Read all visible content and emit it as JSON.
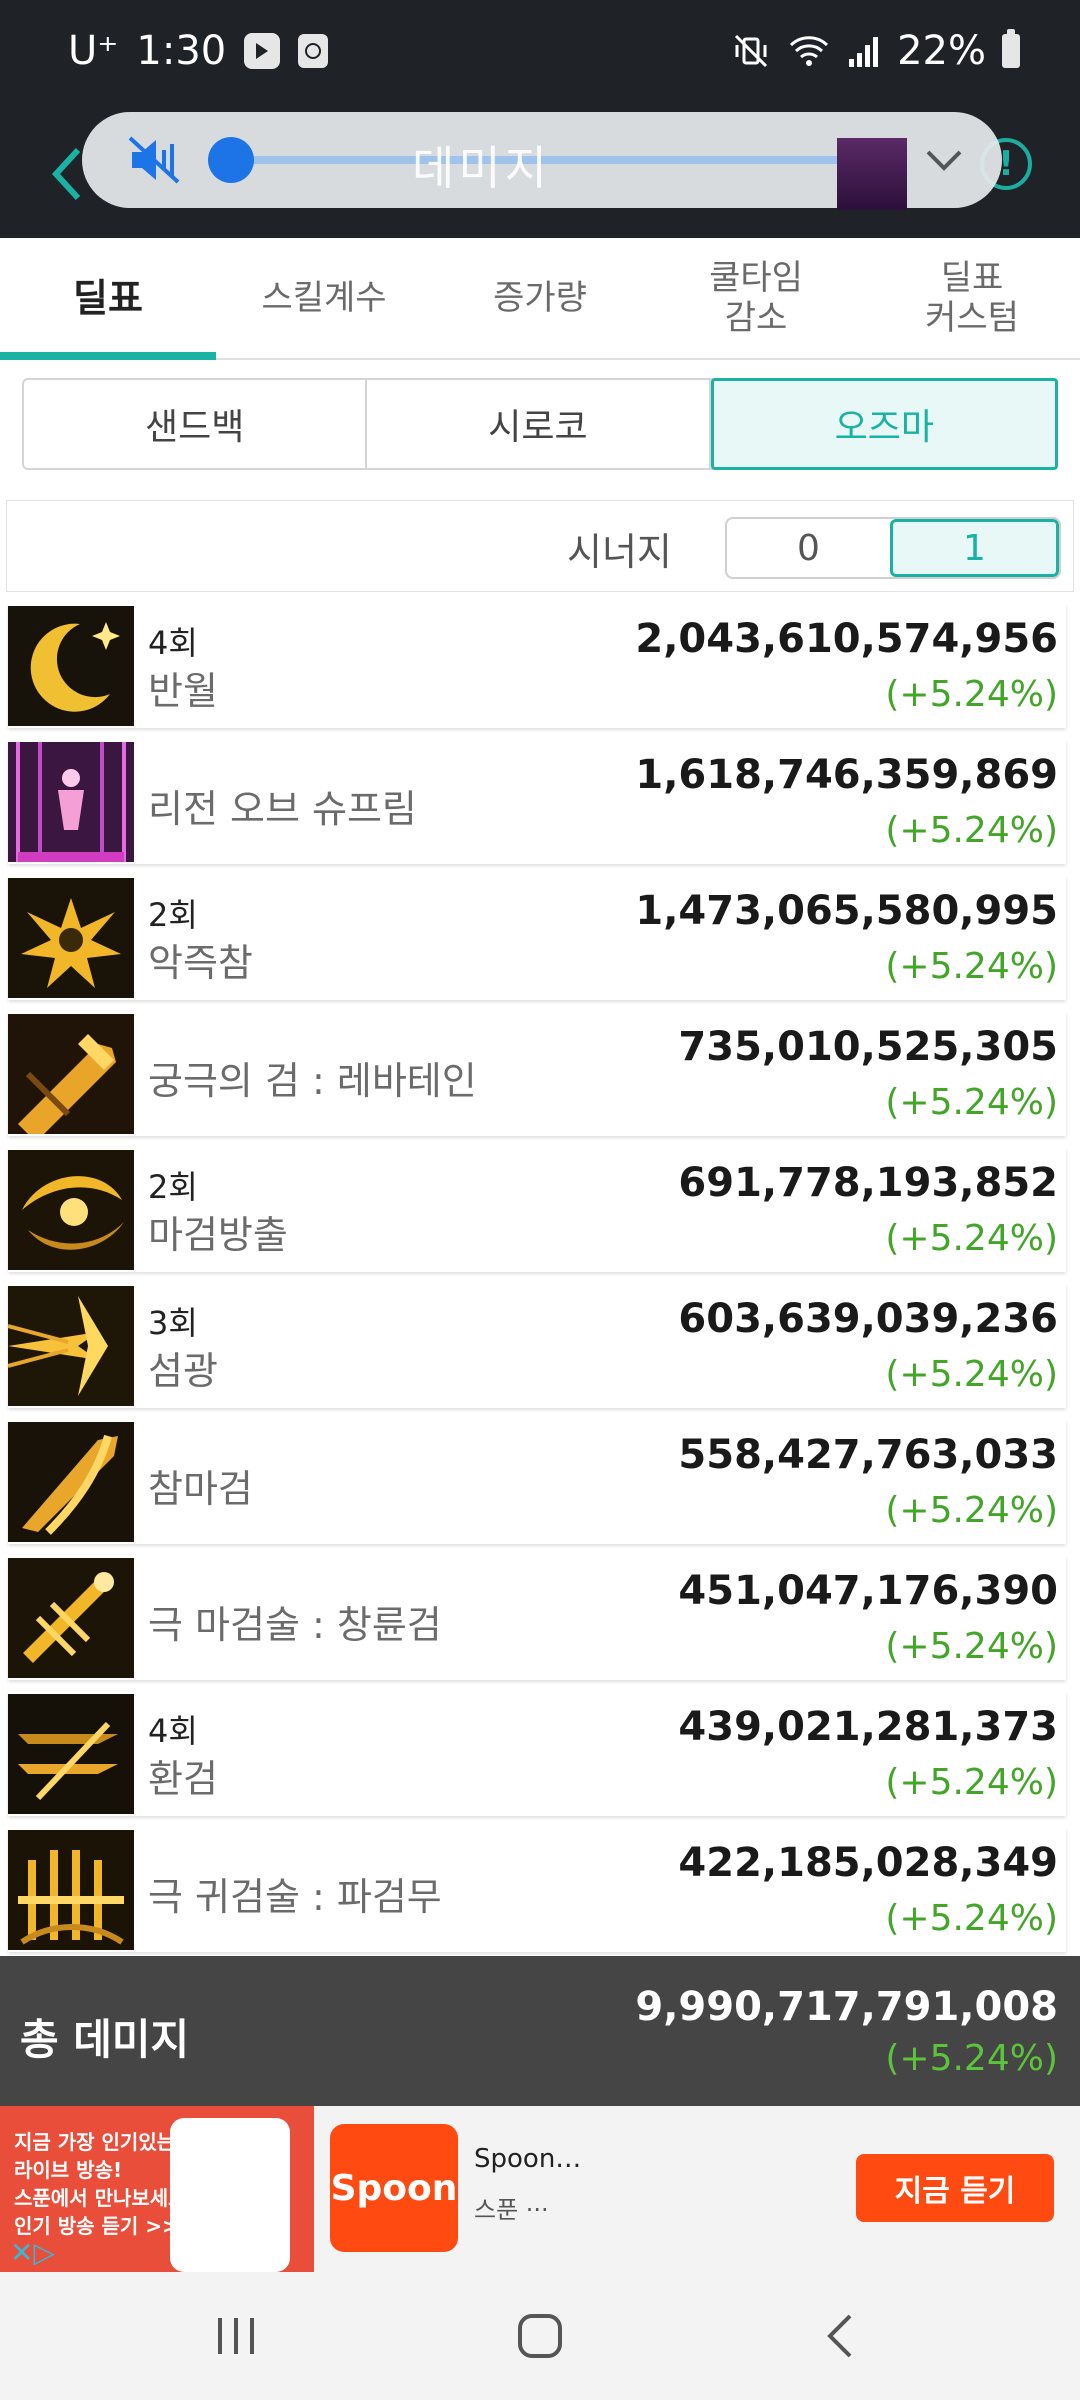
{
  "status_bar": {
    "carrier": "U⁺",
    "time": "1:30",
    "battery": "22%"
  },
  "volume_overlay": {
    "title": "데미지",
    "level": 0
  },
  "tabs": [
    {
      "label": "딜표",
      "active": true
    },
    {
      "label": "스킬계수",
      "active": false
    },
    {
      "label": "증가량",
      "active": false
    },
    {
      "label": "쿨타임\n감소",
      "active": false
    },
    {
      "label": "딜표\n커스텀",
      "active": false
    }
  ],
  "segments": {
    "options": [
      "샌드백",
      "시로코",
      "오즈마"
    ],
    "selected": 2
  },
  "synergy": {
    "label": "시너지",
    "options": [
      "0",
      "1"
    ],
    "selected": 1
  },
  "skills": [
    {
      "count": "4회",
      "name": "반월",
      "damage": "2,043,610,574,956",
      "pct": "(+5.24%)",
      "icon": "crescent-moon-icon"
    },
    {
      "count": "",
      "name": "리전 오브 슈프림",
      "damage": "1,618,746,359,869",
      "pct": "(+5.24%)",
      "icon": "legion-icon"
    },
    {
      "count": "2회",
      "name": "악즉참",
      "damage": "1,473,065,580,995",
      "pct": "(+5.24%)",
      "icon": "slash-burst-icon"
    },
    {
      "count": "",
      "name": "궁극의 검 : 레바테인",
      "damage": "735,010,525,305",
      "pct": "(+5.24%)",
      "icon": "ultimate-sword-icon"
    },
    {
      "count": "2회",
      "name": "마검방출",
      "damage": "691,778,193,852",
      "pct": "(+5.24%)",
      "icon": "demon-sword-icon"
    },
    {
      "count": "3회",
      "name": "섬광",
      "damage": "603,639,039,236",
      "pct": "(+5.24%)",
      "icon": "flash-icon"
    },
    {
      "count": "",
      "name": "참마검",
      "damage": "558,427,763,033",
      "pct": "(+5.24%)",
      "icon": "cleave-icon"
    },
    {
      "count": "",
      "name": "극 마검술 : 창륜검",
      "damage": "451,047,176,390",
      "pct": "(+5.24%)",
      "icon": "spiral-sword-icon"
    },
    {
      "count": "4회",
      "name": "환검",
      "damage": "439,021,281,373",
      "pct": "(+5.24%)",
      "icon": "phantom-sword-icon"
    },
    {
      "count": "",
      "name": "극 귀검술 : 파검무",
      "damage": "422,185,028,349",
      "pct": "(+5.24%)",
      "icon": "blade-dance-icon"
    }
  ],
  "total": {
    "label": "총 데미지",
    "damage": "9,990,717,791,008",
    "pct": "(+5.24%)"
  },
  "ad": {
    "image_text": "지금 가장 인기있는\n라이브 방송!\n스푼에서 만나보세요!\n인기 방송 듣기 >>",
    "logo": "Spoon",
    "title": "Spoon…",
    "subtitle": "스푼 ···",
    "cta": "지금 듣기"
  },
  "colors": {
    "accent": "#19b2a4",
    "positive": "#43a628",
    "dark": "#1f2226",
    "total_bg": "#454545",
    "ad_orange": "#ff4a12"
  }
}
